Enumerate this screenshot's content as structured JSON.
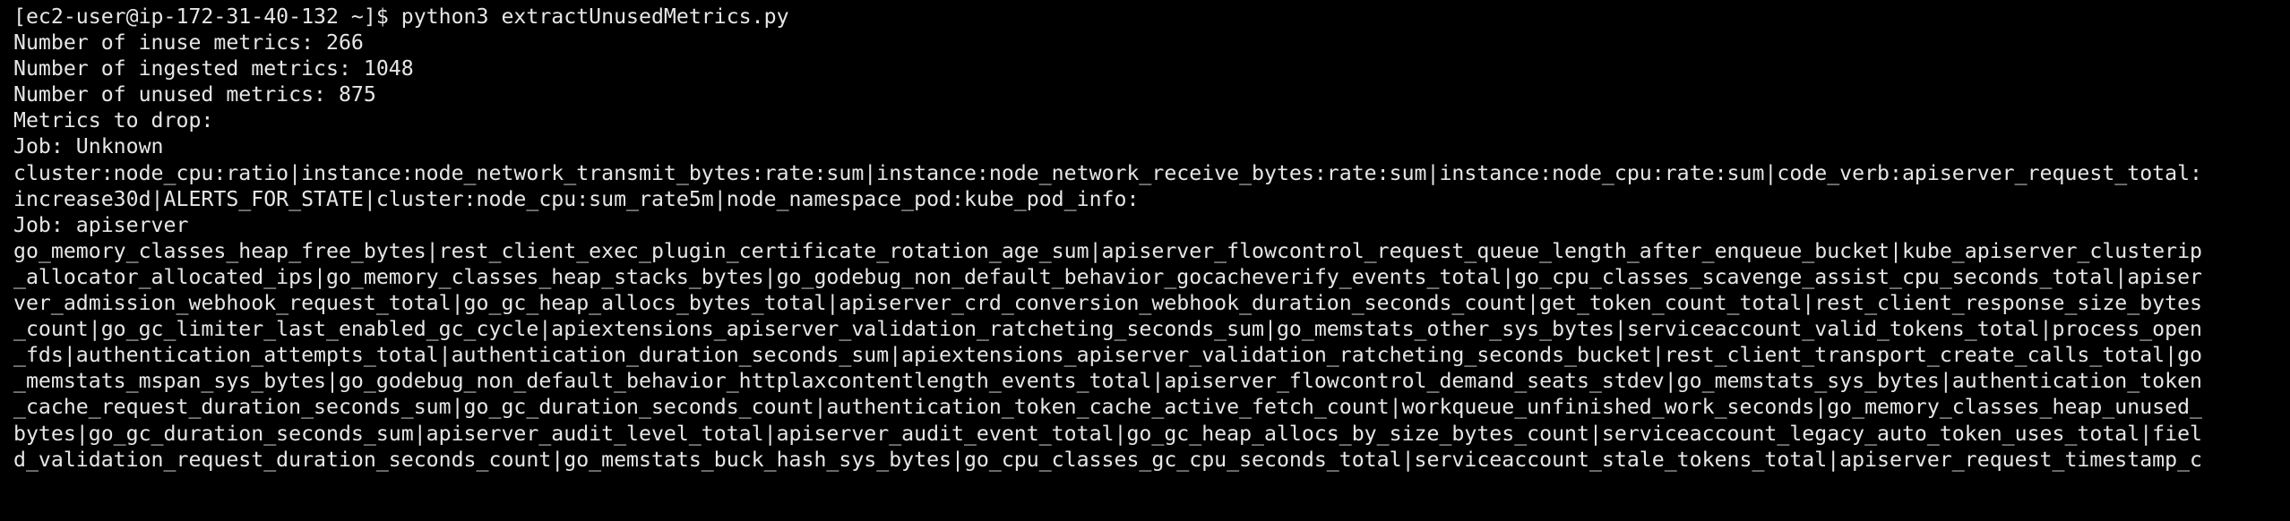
{
  "terminal": {
    "lines": [
      "[ec2-user@ip-172-31-40-132 ~]$ python3 extractUnusedMetrics.py",
      "Number of inuse metrics: 266",
      "Number of ingested metrics: 1048",
      "Number of unused metrics: 875",
      "Metrics to drop:",
      "Job: Unknown",
      "cluster:node_cpu:ratio|instance:node_network_transmit_bytes:rate:sum|instance:node_network_receive_bytes:rate:sum|instance:node_cpu:rate:sum|code_verb:apiserver_request_total:",
      "increase30d|ALERTS_FOR_STATE|cluster:node_cpu:sum_rate5m|node_namespace_pod:kube_pod_info:",
      "Job: apiserver",
      "go_memory_classes_heap_free_bytes|rest_client_exec_plugin_certificate_rotation_age_sum|apiserver_flowcontrol_request_queue_length_after_enqueue_bucket|kube_apiserver_clusterip",
      "_allocator_allocated_ips|go_memory_classes_heap_stacks_bytes|go_godebug_non_default_behavior_gocacheverify_events_total|go_cpu_classes_scavenge_assist_cpu_seconds_total|apiser",
      "ver_admission_webhook_request_total|go_gc_heap_allocs_bytes_total|apiserver_crd_conversion_webhook_duration_seconds_count|get_token_count_total|rest_client_response_size_bytes",
      "_count|go_gc_limiter_last_enabled_gc_cycle|apiextensions_apiserver_validation_ratcheting_seconds_sum|go_memstats_other_sys_bytes|serviceaccount_valid_tokens_total|process_open",
      "_fds|authentication_attempts_total|authentication_duration_seconds_sum|apiextensions_apiserver_validation_ratcheting_seconds_bucket|rest_client_transport_create_calls_total|go",
      "_memstats_mspan_sys_bytes|go_godebug_non_default_behavior_httplaxcontentlength_events_total|apiserver_flowcontrol_demand_seats_stdev|go_memstats_sys_bytes|authentication_token",
      "_cache_request_duration_seconds_sum|go_gc_duration_seconds_count|authentication_token_cache_active_fetch_count|workqueue_unfinished_work_seconds|go_memory_classes_heap_unused_",
      "bytes|go_gc_duration_seconds_sum|apiserver_audit_level_total|apiserver_audit_event_total|go_gc_heap_allocs_by_size_bytes_count|serviceaccount_legacy_auto_token_uses_total|fiel",
      "d_validation_request_duration_seconds_count|go_memstats_buck_hash_sys_bytes|go_cpu_classes_gc_cpu_seconds_total|serviceaccount_stale_tokens_total|apiserver_request_timestamp_c"
    ]
  }
}
